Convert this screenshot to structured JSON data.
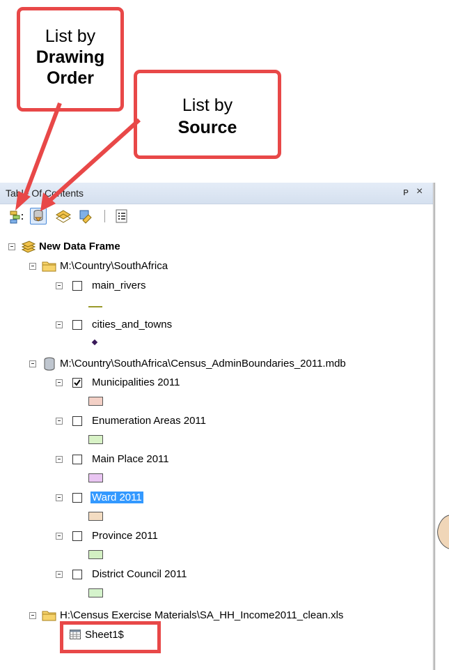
{
  "callouts": {
    "drawing_order": {
      "line1": "List by",
      "line2": "Drawing",
      "line3": "Order"
    },
    "source": {
      "line1": "List by",
      "line2": "Source"
    }
  },
  "toc": {
    "title": "Table Of Contents",
    "pin_glyph": "ᴘ",
    "close_glyph": "×",
    "toolbar": [
      {
        "icon": "list-by-drawing-order-icon"
      },
      {
        "icon": "list-by-source-icon"
      },
      {
        "icon": "list-by-visibility-icon"
      },
      {
        "icon": "list-by-selection-icon"
      },
      {
        "icon": "options-icon"
      }
    ],
    "data_frame": "New Data Frame",
    "folder1": "M:\\Country\\SouthAfrica",
    "layer_main_rivers": "main_rivers",
    "layer_cities": "cities_and_towns",
    "gdb": "M:\\Country\\SouthAfrica\\Census_AdminBoundaries_2011.mdb",
    "layers": [
      {
        "name": "Municipalities 2011",
        "checked": true,
        "color": "#f3d0c6"
      },
      {
        "name": "Enumeration Areas 2011",
        "checked": false,
        "color": "#d8f2c6"
      },
      {
        "name": "Main Place 2011",
        "checked": false,
        "color": "#e9c5f2"
      },
      {
        "name": "Ward 2011",
        "checked": false,
        "color": "#f3dcc2",
        "selected": true
      },
      {
        "name": "Province 2011",
        "checked": false,
        "color": "#d3f0c3"
      },
      {
        "name": "District Council 2011",
        "checked": false,
        "color": "#d5f3cc"
      }
    ],
    "folder2": "H:\\Census Exercise Materials\\SA_HH_Income2011_clean.xls",
    "table": "Sheet1$"
  },
  "colors": {
    "callout_border": "#e84848",
    "selection": "#3399ff",
    "river_line": "#9a9a2a",
    "city_point": "#3a1a5a"
  }
}
